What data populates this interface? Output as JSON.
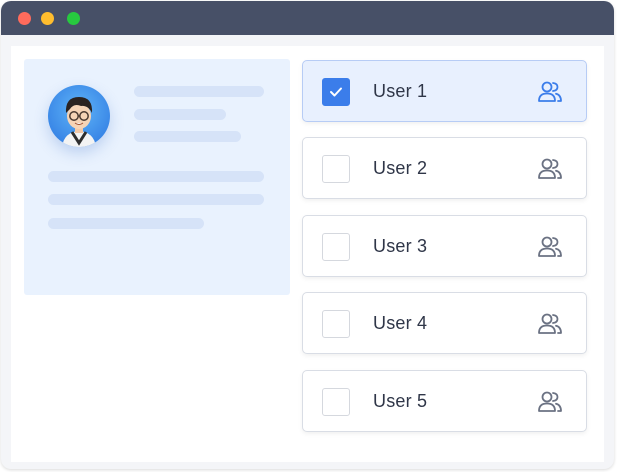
{
  "window": {
    "controls": [
      "close",
      "minimize",
      "maximize"
    ]
  },
  "colors": {
    "accent": "#3b7dea",
    "selected_bg": "#e8f0fe",
    "titlebar": "#475067",
    "card_bg": "#e9f2fe"
  },
  "users": [
    {
      "label": "User 1",
      "checked": true,
      "icon": "users-icon"
    },
    {
      "label": "User 2",
      "checked": false,
      "icon": "users-icon"
    },
    {
      "label": "User 3",
      "checked": false,
      "icon": "users-icon"
    },
    {
      "label": "User 4",
      "checked": false,
      "icon": "users-icon"
    },
    {
      "label": "User 5",
      "checked": false,
      "icon": "users-icon"
    }
  ]
}
